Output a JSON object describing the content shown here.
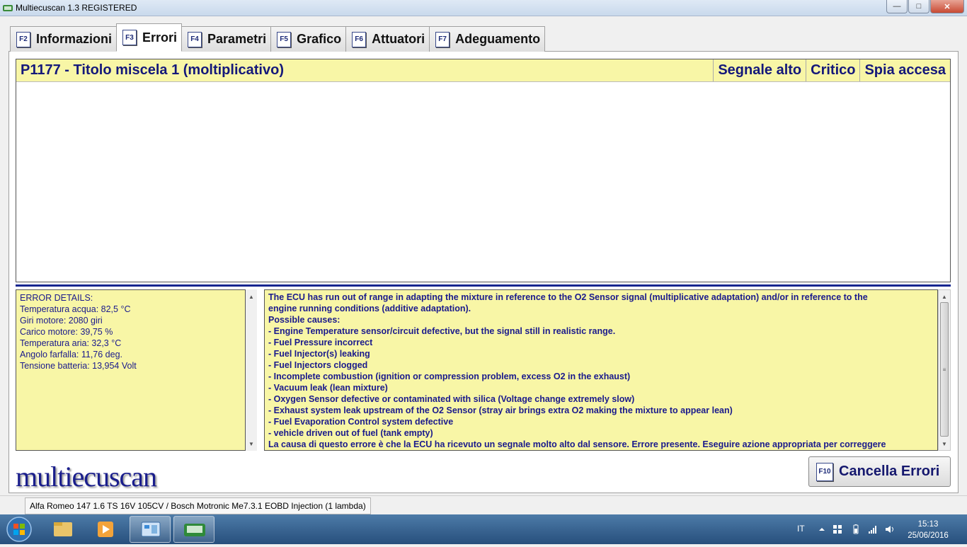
{
  "window": {
    "title": "Multiecuscan 1.3 REGISTERED",
    "minimize": "—",
    "maximize": "□",
    "close": "✕"
  },
  "tabs": [
    {
      "key": "F2",
      "label": "Informazioni"
    },
    {
      "key": "F3",
      "label": "Errori"
    },
    {
      "key": "F4",
      "label": "Parametri"
    },
    {
      "key": "F5",
      "label": "Grafico"
    },
    {
      "key": "F6",
      "label": "Attuatori"
    },
    {
      "key": "F7",
      "label": "Adeguamento"
    }
  ],
  "error_list": {
    "code_title": "P1177 - Titolo miscela 1 (moltiplicativo)",
    "signal": "Segnale alto",
    "severity": "Critico",
    "lamp": "Spia accesa"
  },
  "details": {
    "heading": "ERROR DETAILS:",
    "lines": [
      "Temperatura acqua: 82,5 °C",
      "Giri motore: 2080 giri",
      "Carico motore: 39,75 %",
      "Temperatura aria: 32,3 °C",
      "Angolo farfalla: 11,76 deg.",
      "Tensione batteria: 13,954 Volt"
    ]
  },
  "description": {
    "lines": [
      "The ECU has run out of range in adapting the mixture in reference to the O2 Sensor signal (multiplicative adaptation) and/or in reference to the",
      "engine running conditions (additive adaptation).",
      "Possible causes:",
      "- Engine Temperature sensor/circuit defective, but the signal still in realistic range.",
      "- Fuel Pressure incorrect",
      "- Fuel Injector(s) leaking",
      "- Fuel Injectors clogged",
      "- Incomplete combustion (ignition or compression problem, excess O2 in the exhaust)",
      "- Vacuum leak (lean mixture)",
      "- Oxygen Sensor defective or contaminated with silica (Voltage change extremely slow)",
      "- Exhaust system leak upstream of the O2 Sensor (stray air brings extra O2 making the mixture to appear lean)",
      "- Fuel Evaporation Control system defective",
      "- vehicle driven out of fuel (tank empty)",
      "La causa di questo errore è che la ECU ha ricevuto un segnale molto alto dal sensore. Errore presente. Eseguire azione appropriata per correggere"
    ]
  },
  "logo": "multiecuscan",
  "clear_button": {
    "key": "F10",
    "label": "Cancella Errori"
  },
  "status": {
    "vehicle": "Alfa Romeo 147 1.6 TS 16V 105CV / Bosch Motronic Me7.3.1 EOBD Injection (1 lambda)"
  },
  "taskbar": {
    "language": "IT",
    "time": "15:13",
    "date": "25/06/2016"
  }
}
